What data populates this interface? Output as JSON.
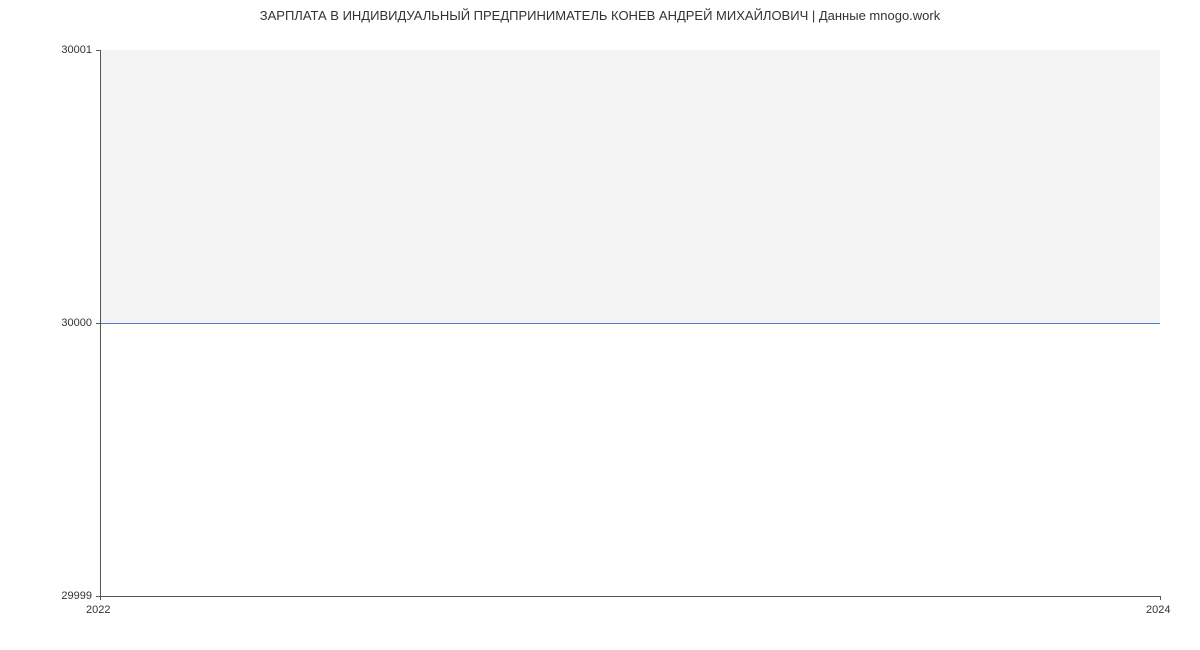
{
  "chart_data": {
    "type": "line",
    "title": "ЗАРПЛАТА В ИНДИВИДУАЛЬНЫЙ ПРЕДПРИНИМАТЕЛЬ КОНЕВ АНДРЕЙ МИХАЙЛОВИЧ | Данные mnogo.work",
    "x": [
      2022,
      2024
    ],
    "values": [
      30000,
      30000
    ],
    "xlabel": "",
    "ylabel": "",
    "xlim": [
      2022,
      2024
    ],
    "ylim": [
      29999,
      30001
    ],
    "x_ticks": [
      2022,
      2024
    ],
    "y_ticks": [
      29999,
      30000,
      30001
    ]
  }
}
